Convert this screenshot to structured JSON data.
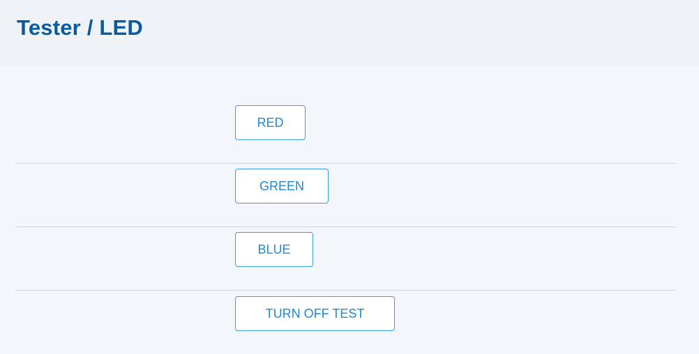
{
  "header": {
    "title": "Tester / LED"
  },
  "buttons": {
    "red": "RED",
    "green": "GREEN",
    "blue": "BLUE",
    "turn_off": "TURN OFF TEST"
  },
  "colors": {
    "title": "#0b5a9c",
    "button_text": "#1e88d6",
    "button_border": "#3a9ae0",
    "background": "#f3f6fa"
  }
}
